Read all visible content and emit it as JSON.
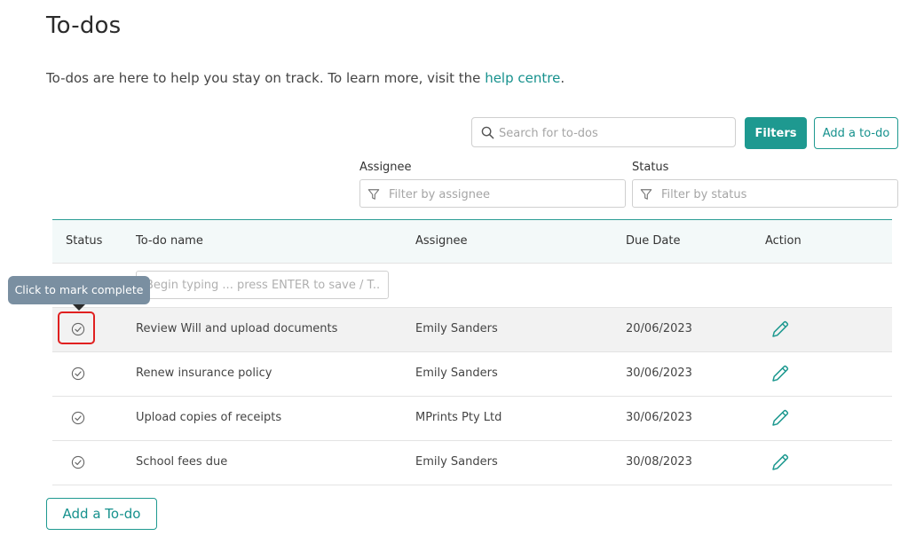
{
  "page": {
    "title": "To-dos",
    "intro_text": "To-dos are here to help you stay on track. To learn more, visit the ",
    "intro_link": "help centre",
    "intro_end": "."
  },
  "toolbar": {
    "search_placeholder": "Search for to-dos",
    "filters_label": "Filters",
    "add_label": "Add a to-do"
  },
  "filters": {
    "assignee_label": "Assignee",
    "assignee_placeholder": "Filter by assignee",
    "status_label": "Status",
    "status_placeholder": "Filter by status"
  },
  "table": {
    "columns": {
      "status": "Status",
      "name": "To-do name",
      "assignee": "Assignee",
      "due": "Due Date",
      "action": "Action"
    },
    "new_placeholder": "Begin typing ... press ENTER to save / T...",
    "rows": [
      {
        "name": "Review Will and upload documents",
        "assignee": "Emily Sanders",
        "due": "20/06/2023"
      },
      {
        "name": "Renew insurance policy",
        "assignee": "Emily Sanders",
        "due": "30/06/2023"
      },
      {
        "name": "Upload copies of receipts",
        "assignee": "MPrints Pty Ltd",
        "due": "30/06/2023"
      },
      {
        "name": "School fees due",
        "assignee": "Emily Sanders",
        "due": "30/08/2023"
      }
    ]
  },
  "tooltip": {
    "text": "Click to mark complete"
  },
  "footer": {
    "add_label": "Add a To-do"
  },
  "icons": {
    "search": "search-icon",
    "filter": "filter-icon",
    "check": "check-circle-icon",
    "edit": "pencil-icon"
  },
  "colors": {
    "accent": "#1e9990",
    "link": "#16918d",
    "tooltip_bg": "#7a8fa1",
    "highlight_row": "#f2f2f2",
    "focus_ring": "#e02020"
  }
}
